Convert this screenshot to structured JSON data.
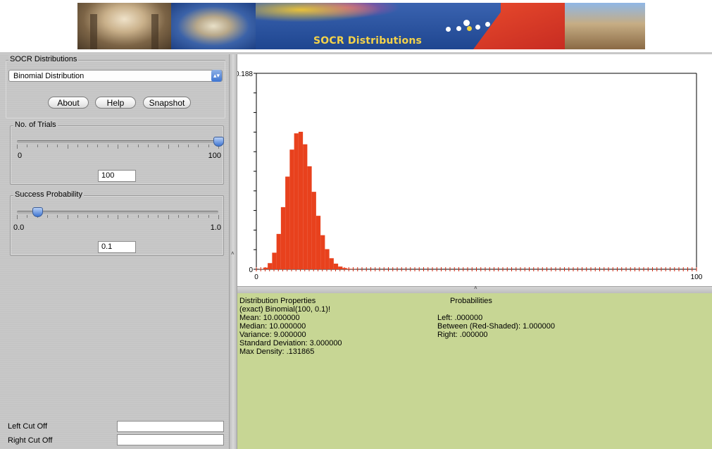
{
  "banner": {
    "title": "SOCR Distributions"
  },
  "sidebar": {
    "group_title": "SOCR Distributions",
    "selected_distribution": "Binomial Distribution",
    "buttons": {
      "about": "About",
      "help": "Help",
      "snapshot": "Snapshot"
    },
    "trials": {
      "title": "No. of Trials",
      "min_label": "0",
      "max_label": "100",
      "value": "100",
      "position": 1.0
    },
    "probability": {
      "title": "Success Probability",
      "min_label": "0.0",
      "max_label": "1.0",
      "value": "0.1",
      "position": 0.1
    },
    "left_cutoff_label": "Left Cut Off",
    "right_cutoff_label": "Right Cut Off",
    "left_cutoff_value": "",
    "right_cutoff_value": ""
  },
  "chart_data": {
    "type": "bar",
    "title": "",
    "xlabel": "",
    "ylabel": "",
    "x_tick_labels": [
      "0",
      "100"
    ],
    "y_tick_labels": [
      "0",
      "0.188"
    ],
    "xlim": [
      0,
      100
    ],
    "ylim": [
      0,
      0.188
    ],
    "bar_color": "#e8411d",
    "x": [
      0,
      1,
      2,
      3,
      4,
      5,
      6,
      7,
      8,
      9,
      10,
      11,
      12,
      13,
      14,
      15,
      16,
      17,
      18,
      19,
      20,
      21,
      22,
      23,
      24,
      25
    ],
    "values": [
      0.0,
      0.0003,
      0.0016,
      0.0059,
      0.0159,
      0.0339,
      0.0596,
      0.0889,
      0.1148,
      0.1304,
      0.1319,
      0.1199,
      0.0988,
      0.0743,
      0.0513,
      0.0327,
      0.0193,
      0.0106,
      0.0054,
      0.0026,
      0.0012,
      0.0005,
      0.0002,
      0.0001,
      0.0,
      0.0
    ]
  },
  "properties": {
    "heading": "Distribution Properties",
    "model": "(exact) Binomial(100, 0.1)!",
    "mean": "Mean: 10.000000",
    "median": "Median: 10.000000",
    "variance": "Variance: 9.000000",
    "std": "Standard Deviation: 3.000000",
    "max_density": "Max Density: .131865"
  },
  "probabilities": {
    "heading": "Probabilities",
    "left": "Left: .000000",
    "between": "Between (Red-Shaded): 1.000000",
    "right": "Right: .000000"
  },
  "colors": {
    "info_bg": "#c7d694",
    "bars": "#e8411d"
  }
}
